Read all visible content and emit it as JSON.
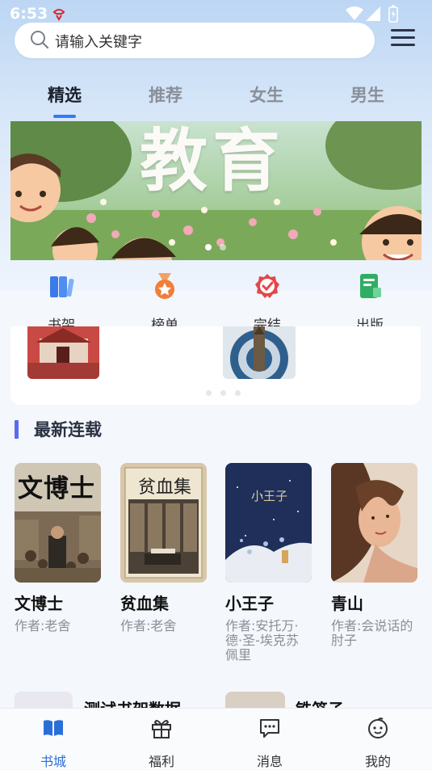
{
  "status": {
    "time": "6:53"
  },
  "search": {
    "placeholder": "请输入关键字"
  },
  "tabs": [
    {
      "label": "精选",
      "active": true
    },
    {
      "label": "推荐"
    },
    {
      "label": "女生"
    },
    {
      "label": "男生"
    }
  ],
  "banner": {
    "text": "教育",
    "slide": 1,
    "slides": 2
  },
  "quick_nav": [
    {
      "label": "书架",
      "icon": "bookshelf-icon"
    },
    {
      "label": "榜单",
      "icon": "medal-icon"
    },
    {
      "label": "完结",
      "icon": "check-badge-icon"
    },
    {
      "label": "出版",
      "icon": "publish-icon"
    }
  ],
  "recommend": {
    "slides": 3,
    "slide": 1
  },
  "section": {
    "title": "最新连载"
  },
  "books": [
    {
      "title": "文博士",
      "author": "作者:老舍",
      "cover_text": "文博士"
    },
    {
      "title": "贫血集",
      "author": "作者:老舍",
      "cover_text": "贫血集"
    },
    {
      "title": "小王子",
      "author": "作者:安托万·德·圣-埃克苏佩里",
      "cover_text": "小王子"
    },
    {
      "title": "青山",
      "author": "作者:会说话的肘子"
    }
  ],
  "partial_books": [
    {
      "title": "测试书架数据"
    },
    {
      "title": "铁笼子"
    }
  ],
  "bottom_nav": [
    {
      "label": "书城",
      "icon": "book-icon",
      "active": true
    },
    {
      "label": "福利",
      "icon": "gift-icon"
    },
    {
      "label": "消息",
      "icon": "message-icon"
    },
    {
      "label": "我的",
      "icon": "profile-icon"
    }
  ],
  "colors": {
    "accent": "#2f7bff",
    "section_bar": "#5b6af2",
    "nav_active": "#2a6fd8"
  }
}
